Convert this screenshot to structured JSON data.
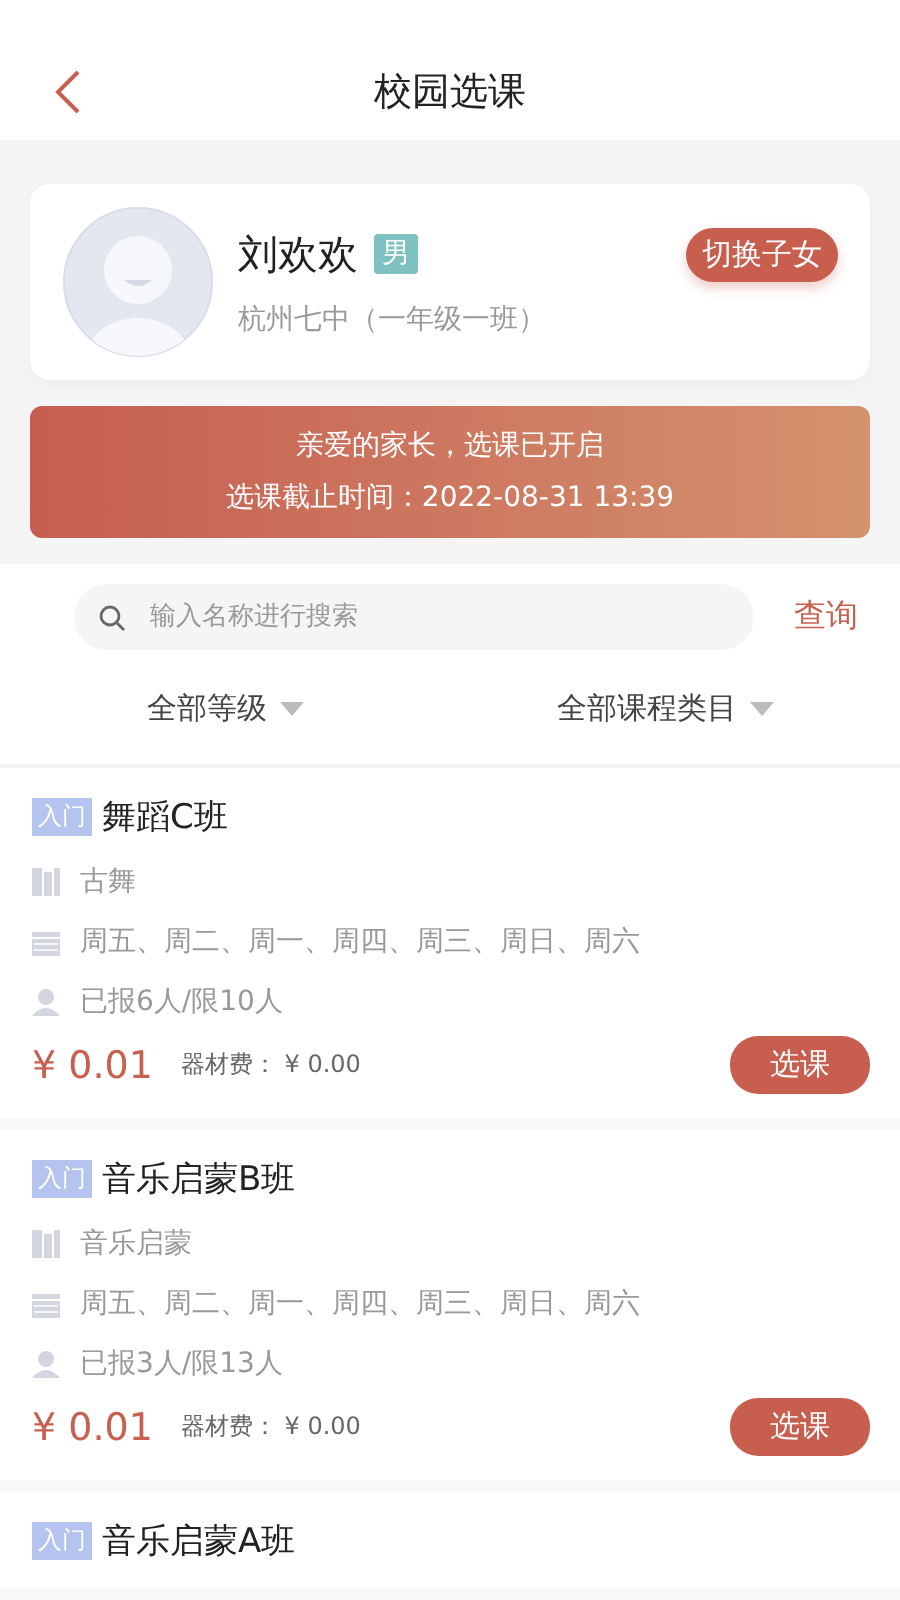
{
  "nav": {
    "title": "校园选课"
  },
  "student": {
    "name": "刘欢欢",
    "gender": "男",
    "school": "杭州七中（一年级一班）",
    "switch_button": "切换子女"
  },
  "notice": {
    "line1": "亲爱的家长，选课已开启",
    "line2": "选课截止时间：2022-08-31 13:39"
  },
  "search": {
    "placeholder": "输入名称进行搜索",
    "button": "查询"
  },
  "filters": [
    "全部等级",
    "全部课程类目"
  ],
  "courses": [
    {
      "level": "入门",
      "name": "舞蹈C班",
      "category": "古舞",
      "days": "周五、周二、周一、周四、周三、周日、周六",
      "enrollment": "已报6人/限10人",
      "price": "¥ 0.01",
      "material_fee": "器材费： ¥ 0.00",
      "button": "选课"
    },
    {
      "level": "入门",
      "name": "音乐启蒙B班",
      "category": "音乐启蒙",
      "days": "周五、周二、周一、周四、周三、周日、周六",
      "enrollment": "已报3人/限13人",
      "price": "¥ 0.01",
      "material_fee": "器材费： ¥ 0.00",
      "button": "选课"
    },
    {
      "level": "入门",
      "name": "音乐启蒙A班"
    }
  ]
}
